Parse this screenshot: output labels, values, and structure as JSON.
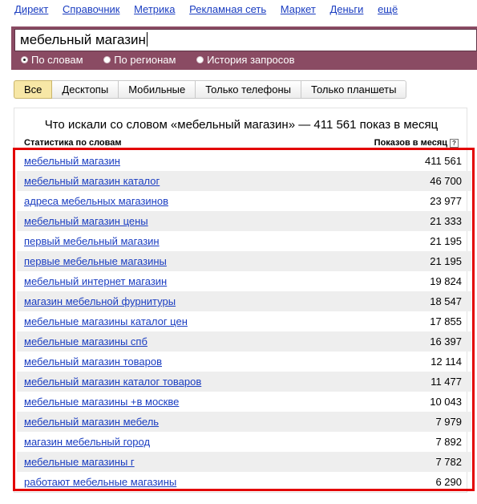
{
  "nav": [
    "Директ",
    "Справочник",
    "Метрика",
    "Рекламная сеть",
    "Маркет",
    "Деньги",
    "ещё"
  ],
  "search": {
    "value": "мебельный магазин"
  },
  "modes": [
    {
      "label": "По словам",
      "selected": true
    },
    {
      "label": "По регионам",
      "selected": false
    },
    {
      "label": "История запросов",
      "selected": false
    }
  ],
  "tabs": [
    "Все",
    "Десктопы",
    "Мобильные",
    "Только телефоны",
    "Только планшеты"
  ],
  "active_tab": "Все",
  "panel": {
    "title": "Что искали со словом «мебельный магазин» — 411 561 показ в месяц",
    "col_words": "Статистика по словам",
    "col_shows": "Показов в месяц",
    "help": "?"
  },
  "rows": [
    {
      "phrase": "мебельный магазин",
      "count": "411 561"
    },
    {
      "phrase": "мебельный магазин каталог",
      "count": "46 700"
    },
    {
      "phrase": "адреса мебельных магазинов",
      "count": "23 977"
    },
    {
      "phrase": "мебельный магазин цены",
      "count": "21 333"
    },
    {
      "phrase": "первый мебельный магазин",
      "count": "21 195"
    },
    {
      "phrase": "первые мебельные магазины",
      "count": "21 195"
    },
    {
      "phrase": "мебельный интернет магазин",
      "count": "19 824"
    },
    {
      "phrase": "магазин мебельной фурнитуры",
      "count": "18 547"
    },
    {
      "phrase": "мебельные магазины каталог цен",
      "count": "17 855"
    },
    {
      "phrase": "мебельные магазины спб",
      "count": "16 397"
    },
    {
      "phrase": "мебельный магазин товаров",
      "count": "12 114"
    },
    {
      "phrase": "мебельный магазин каталог товаров",
      "count": "11 477"
    },
    {
      "phrase": "мебельные магазины +в москве",
      "count": "10 043"
    },
    {
      "phrase": "мебельный магазин мебель",
      "count": "7 979"
    },
    {
      "phrase": "магазин мебельный город",
      "count": "7 892"
    },
    {
      "phrase": "мебельные магазины г",
      "count": "7 782"
    },
    {
      "phrase": "работают мебельные магазины",
      "count": "6 290"
    }
  ]
}
